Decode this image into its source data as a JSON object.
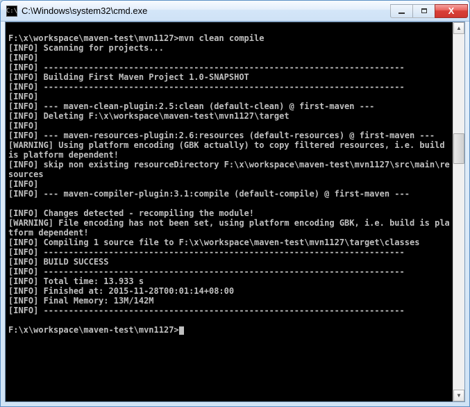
{
  "window": {
    "title": "C:\\Windows\\system32\\cmd.exe",
    "icon_label": "C:\\"
  },
  "controls": {
    "min_tip": "Minimize",
    "max_tip": "Maximize",
    "close_tip": "Close",
    "close_glyph": "X"
  },
  "console": {
    "blank": "",
    "prompt1": "F:\\x\\workspace\\maven-test\\mvn1127>mvn clean compile",
    "l01": "[INFO] Scanning for projects...",
    "l02": "[INFO]",
    "l03": "[INFO] ------------------------------------------------------------------------",
    "l04": "[INFO] Building First Maven Project 1.0-SNAPSHOT",
    "l05": "[INFO] ------------------------------------------------------------------------",
    "l06": "[INFO]",
    "l07": "[INFO] --- maven-clean-plugin:2.5:clean (default-clean) @ first-maven ---",
    "l08": "[INFO] Deleting F:\\x\\workspace\\maven-test\\mvn1127\\target",
    "l09": "[INFO]",
    "l10": "[INFO] --- maven-resources-plugin:2.6:resources (default-resources) @ first-maven ---",
    "l11": "[WARNING] Using platform encoding (GBK actually) to copy filtered resources, i.e. build is platform dependent!",
    "l12": "[INFO] skip non existing resourceDirectory F:\\x\\workspace\\maven-test\\mvn1127\\src\\main\\resources",
    "l13": "[INFO]",
    "l14": "[INFO] --- maven-compiler-plugin:3.1:compile (default-compile) @ first-maven ---",
    "l15": "[INFO] Changes detected - recompiling the module!",
    "l16": "[WARNING] File encoding has not been set, using platform encoding GBK, i.e. build is platform dependent!",
    "l17": "[INFO] Compiling 1 source file to F:\\x\\workspace\\maven-test\\mvn1127\\target\\classes",
    "l18": "[INFO] ------------------------------------------------------------------------",
    "l19": "[INFO] BUILD SUCCESS",
    "l20": "[INFO] ------------------------------------------------------------------------",
    "l21": "[INFO] Total time: 13.933 s",
    "l22": "[INFO] Finished at: 2015-11-28T00:01:14+08:00",
    "l23": "[INFO] Final Memory: 13M/142M",
    "l24": "[INFO] ------------------------------------------------------------------------",
    "prompt2": "F:\\x\\workspace\\maven-test\\mvn1127>"
  }
}
